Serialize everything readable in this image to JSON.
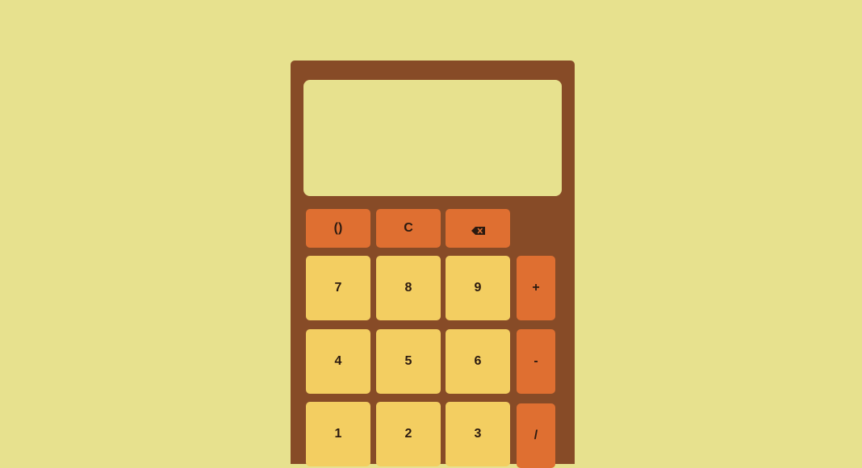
{
  "calculator": {
    "display": {
      "value": ""
    },
    "function_row": [
      {
        "label": "()",
        "name": "parentheses-button"
      },
      {
        "label": "C",
        "name": "clear-button"
      },
      {
        "label": "",
        "name": "backspace-button",
        "icon": "backspace-icon"
      }
    ],
    "keys": {
      "seven": "7",
      "eight": "8",
      "nine": "9",
      "plus": "+",
      "four": "4",
      "five": "5",
      "six": "6",
      "minus": "-",
      "one": "1",
      "two": "2",
      "three": "3",
      "divide": "/"
    }
  },
  "colors": {
    "page_background": "#e7e18e",
    "body": "#874b27",
    "display": "#e7e18e",
    "number_key": "#f3ce61",
    "function_key": "#df6f31",
    "text": "#2b1a10"
  }
}
